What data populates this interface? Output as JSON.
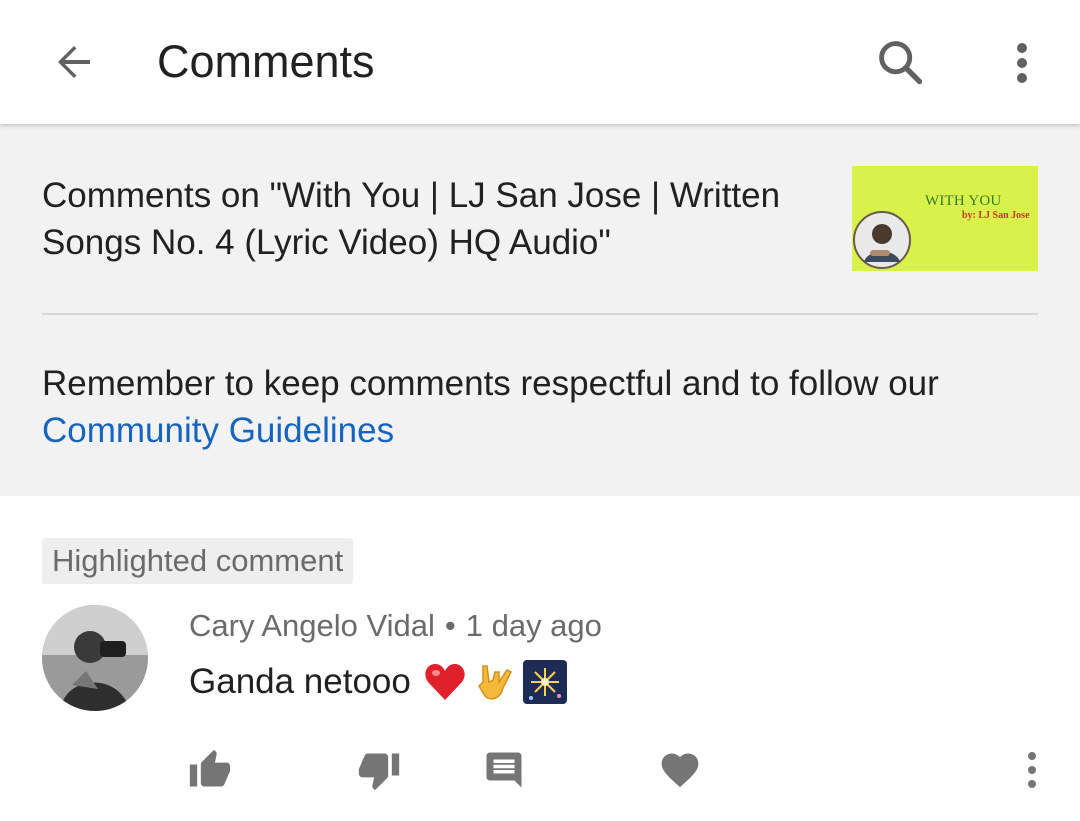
{
  "appbar": {
    "title": "Comments",
    "back_icon": "arrow-left-icon",
    "search_icon": "search-icon",
    "more_icon": "more-vert-icon"
  },
  "video": {
    "title": "Comments on \"With You | LJ San Jose | Written Songs No. 4 (Lyric Video) HQ Audio\"",
    "thumbnail": {
      "title": "WITH YOU",
      "by": "by: LJ San Jose",
      "background_color": "#d9f24a"
    }
  },
  "reminder": {
    "text": "Remember to keep comments respectful and to follow our ",
    "link_label": "Community Guidelines",
    "link_color": "#1565c0"
  },
  "comment": {
    "highlight_label": "Highlighted comment",
    "author": "Cary Angelo Vidal",
    "separator": "•",
    "time": "1 day ago",
    "text": "Ganda netooo",
    "emojis": [
      "red-heart-icon",
      "love-you-gesture-icon",
      "fireworks-icon"
    ],
    "actions": [
      "thumb-up-icon",
      "thumb-down-icon",
      "reply-icon",
      "heart-icon",
      "more-vert-icon"
    ]
  }
}
